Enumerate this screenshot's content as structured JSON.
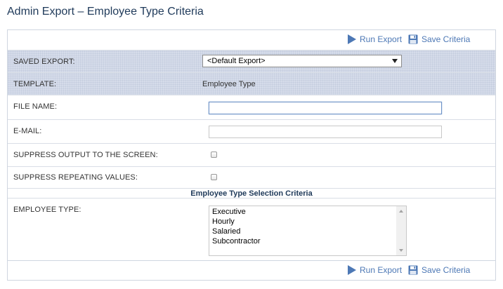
{
  "page": {
    "title": "Admin Export – Employee Type Criteria"
  },
  "toolbar": {
    "run_label": "Run Export",
    "save_label": "Save Criteria"
  },
  "form": {
    "saved_export": {
      "label": "SAVED EXPORT:",
      "value": "<Default Export>"
    },
    "template": {
      "label": "TEMPLATE:",
      "value": "Employee Type"
    },
    "file_name": {
      "label": "FILE NAME:",
      "value": ""
    },
    "email": {
      "label": "E-MAIL:",
      "value": ""
    },
    "suppress_output": {
      "label": "SUPPRESS OUTPUT TO THE SCREEN:"
    },
    "suppress_repeating": {
      "label": "SUPPRESS REPEATING VALUES:"
    }
  },
  "criteria": {
    "section_title": "Employee Type Selection Criteria",
    "employee_type": {
      "label": "EMPLOYEE TYPE:",
      "options": [
        "Executive",
        "Hourly",
        "Salaried",
        "Subcontractor"
      ]
    }
  },
  "colors": {
    "accent": "#4d78b5",
    "shaded_row": "#d6dcea",
    "title": "#1f3a5a"
  },
  "icons": {
    "run": "play-icon",
    "save": "floppy-disk-icon"
  }
}
